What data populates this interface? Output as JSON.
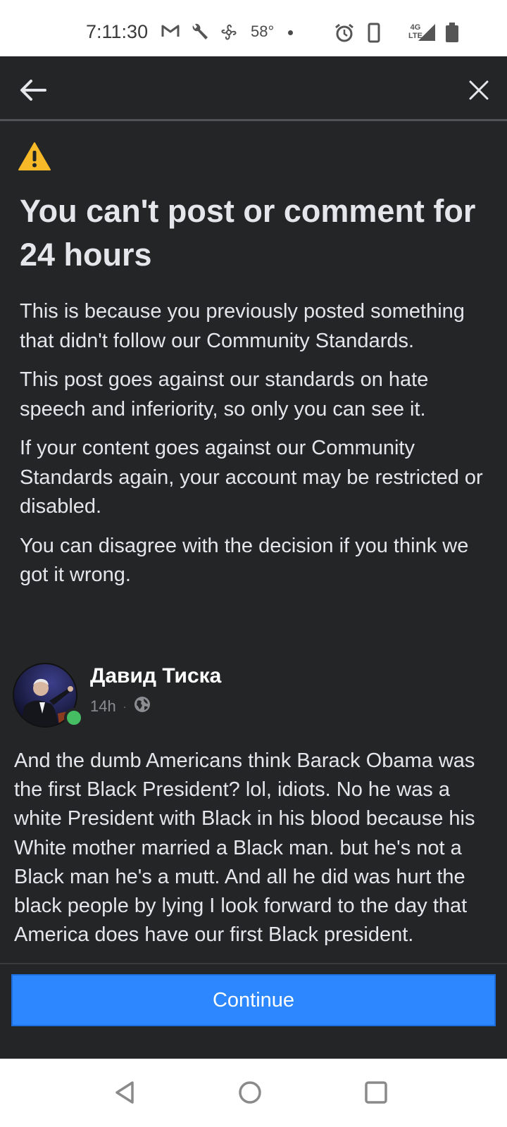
{
  "status_bar": {
    "time": "7:11:30",
    "temperature": "58°",
    "network": "4G LTE",
    "icons": [
      "gmail-icon",
      "wrench-icon",
      "fan-icon",
      "alarm-icon",
      "phone-vibrate-icon",
      "signal-icon",
      "battery-icon"
    ]
  },
  "dialog": {
    "back_icon": "back-arrow-icon",
    "close_icon": "close-icon",
    "warning_icon": "warning-icon",
    "headline": "You can't post or comment for 24 hours",
    "paragraphs": [
      "This is because you previously posted something that didn't follow our Community Standards.",
      "This post goes against our standards on hate speech and inferiority, so only you can see it.",
      "If your content goes against our Community Standards again, your account may be restricted or disabled.",
      "You can disagree with the decision if you think we got it wrong."
    ]
  },
  "post": {
    "author": "Давид Тиска",
    "time": "14h",
    "separator": "·",
    "privacy_icon": "globe-icon",
    "text": "And the dumb Americans think Barack Obama was the first Black President? lol, idiots. No he was a white President with Black in his blood because his White mother married a Black man. but he's not a Black man he's a mutt. And all he did was hurt the black people by lying I look forward to the day that America  does have our first Black president."
  },
  "continue_button": {
    "label": "Continue"
  },
  "nav_bar": {
    "icons": [
      "nav-back-icon",
      "nav-home-icon",
      "nav-recents-icon"
    ]
  },
  "colors": {
    "panel_bg": "#242526",
    "text": "#e4e6eb",
    "secondary_text": "#8a8d91",
    "accent": "#2d88ff",
    "warning": "#f7b928",
    "online": "#45bd62"
  }
}
